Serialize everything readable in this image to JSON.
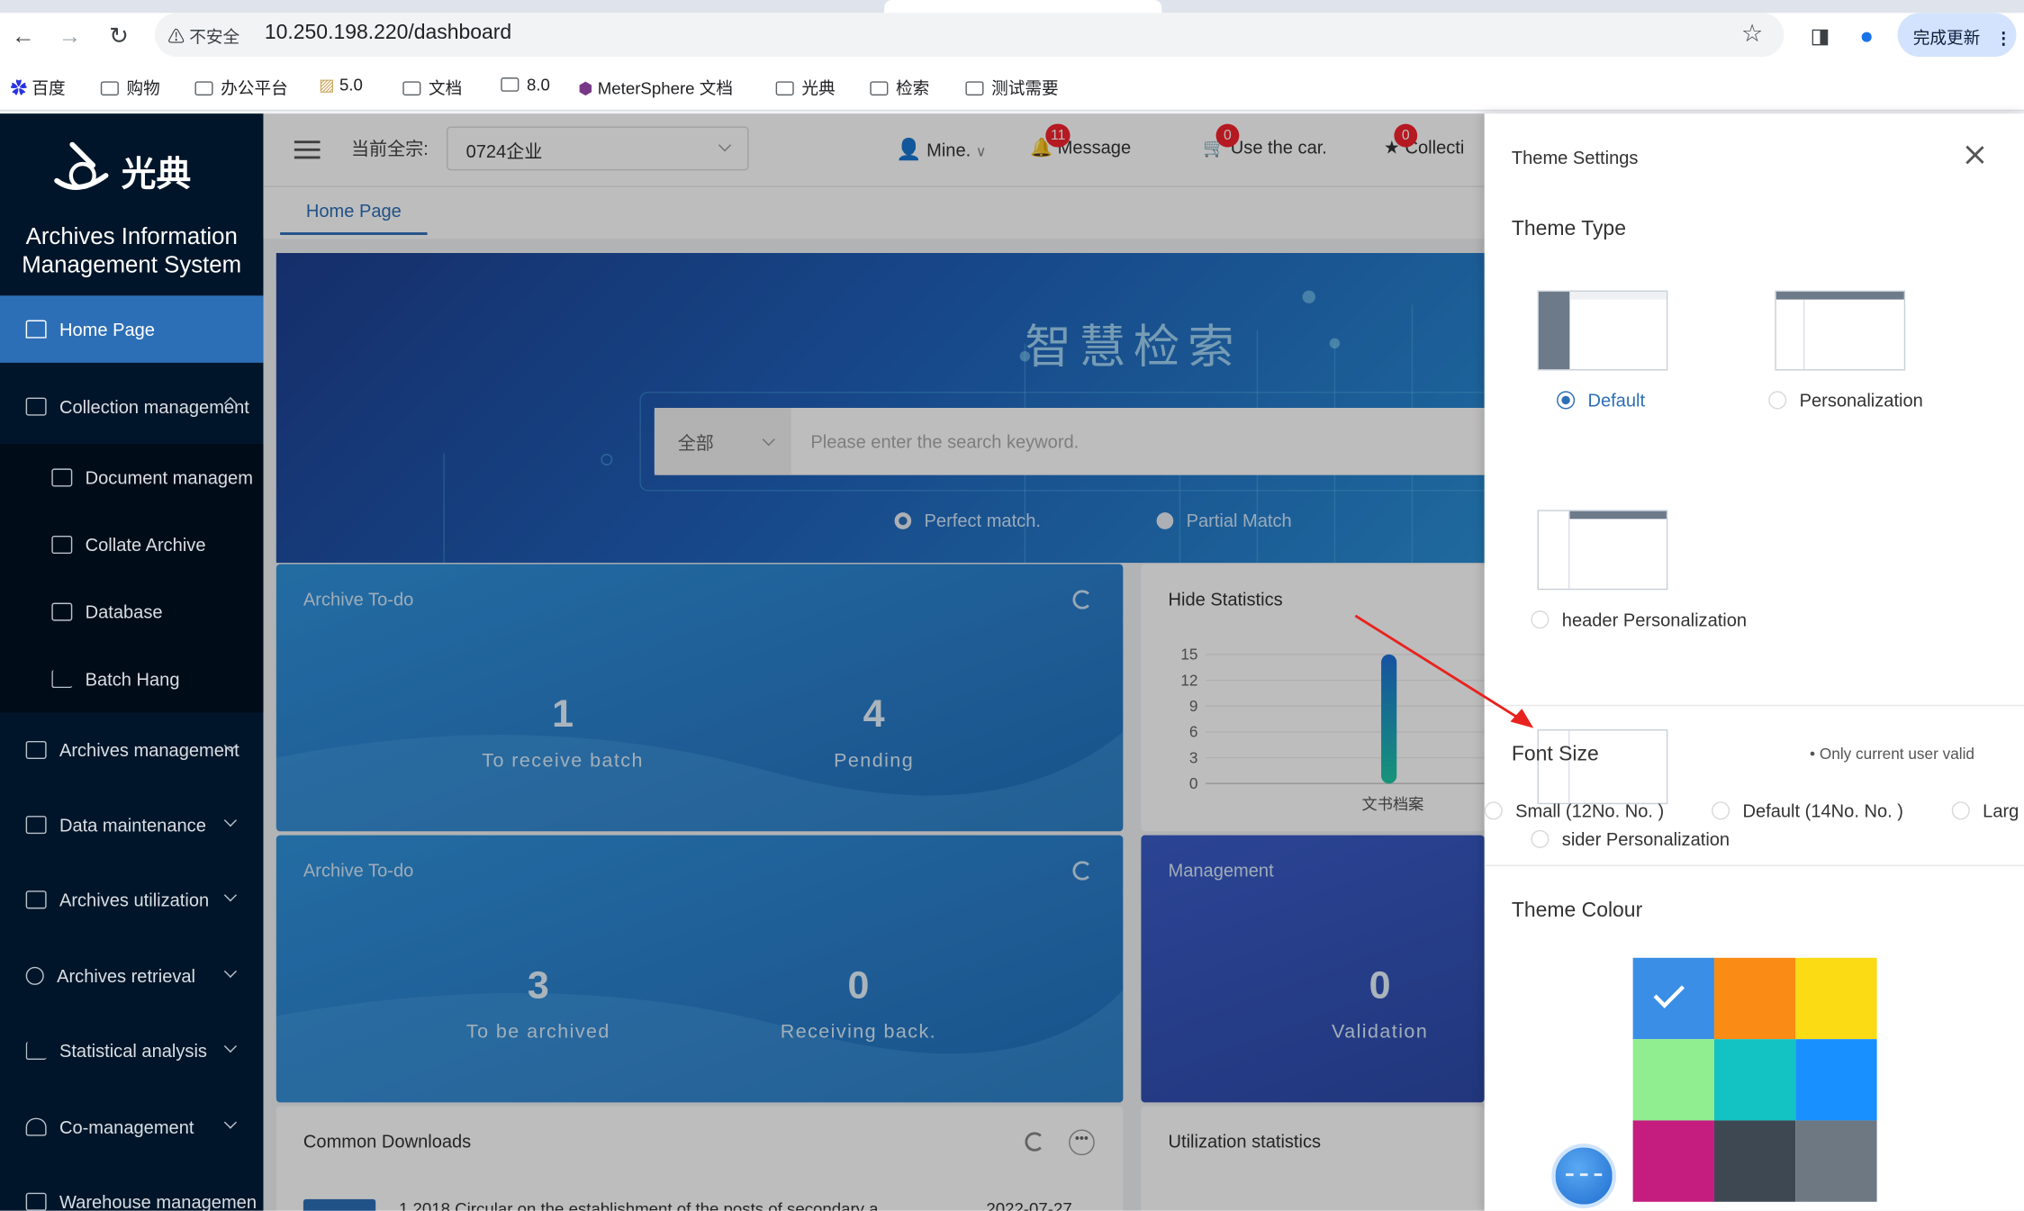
{
  "browser": {
    "insecure_label": "不安全",
    "url": "10.250.198.220/dashboard",
    "update_label": "完成更新",
    "bookmarks": [
      "百度",
      "购物",
      "办公平台",
      "5.0",
      "文档",
      "8.0",
      "MeterSphere 文档",
      "光典",
      "检索",
      "测试需要"
    ]
  },
  "app": {
    "logo_text": "光典",
    "system_title_line1": "Archives Information",
    "system_title_line2": "Management System"
  },
  "sidebar": {
    "items": [
      {
        "label": "Home Page",
        "icon": "home-icon"
      },
      {
        "label": "Collection management",
        "icon": "collection-icon"
      },
      {
        "label": "Document managem",
        "icon": "document-icon"
      },
      {
        "label": "Collate Archive",
        "icon": "file-icon"
      },
      {
        "label": "Database",
        "icon": "calendar-icon"
      },
      {
        "label": "Batch Hang",
        "icon": "bar-chart-icon"
      },
      {
        "label": "Archives management",
        "icon": "bank-icon"
      },
      {
        "label": "Data maintenance",
        "icon": "building-icon"
      },
      {
        "label": "Archives utilization",
        "icon": "clipboard-icon"
      },
      {
        "label": "Archives retrieval",
        "icon": "search-icon"
      },
      {
        "label": "Statistical analysis",
        "icon": "line-chart-icon"
      },
      {
        "label": "Co-management",
        "icon": "team-icon"
      },
      {
        "label": "Warehouse managemen",
        "icon": "warehouse-icon"
      }
    ]
  },
  "header": {
    "current_label": "当前全宗:",
    "current_value": "0724企业",
    "user": "Mine.",
    "message_label": "Message",
    "message_count": "11",
    "car_label": "Use the car.",
    "car_count": "0",
    "collect_label": "Collecti",
    "collect_count": "0"
  },
  "tabs": {
    "home": "Home Page"
  },
  "banner": {
    "title": "智慧检索",
    "scope": "全部",
    "placeholder": "Please enter the search keyword.",
    "match_exact": "Perfect match.",
    "match_partial": "Partial Match"
  },
  "cards": {
    "todo1": {
      "title": "Archive To-do",
      "a_value": "1",
      "a_label": "To receive batch",
      "b_value": "4",
      "b_label": "Pending"
    },
    "todo2": {
      "title": "Archive To-do",
      "a_value": "3",
      "a_label": "To be archived",
      "b_value": "0",
      "b_label": "Receiving back."
    },
    "hide_stats": {
      "title": "Hide Statistics",
      "ticks": [
        "15",
        "12",
        "9",
        "6",
        "3",
        "0"
      ],
      "bar_label": "文书档案"
    },
    "management": {
      "title": "Management",
      "value": "0",
      "label": "Validation"
    },
    "downloads": {
      "title": "Common Downloads",
      "row_text": "1.2018 Circular on the establishment of the posts of secondary a",
      "row_date": "2022-07-27"
    },
    "utilization": {
      "title": "Utilization statistics"
    }
  },
  "chart_data": {
    "type": "bar",
    "categories": [
      "文书档案"
    ],
    "values": [
      15
    ],
    "title": "Hide Statistics",
    "ylim": [
      0,
      15
    ]
  },
  "drawer": {
    "title": "Theme Settings",
    "theme_type_title": "Theme Type",
    "theme_options": [
      "Default",
      "Personalization",
      "header Personalization",
      "sider Personalization"
    ],
    "font_size_title": "Font Size",
    "font_note": "Only current user valid",
    "font_options": [
      "Small (12No. No. )",
      "Default (14No. No. )",
      "Larg"
    ],
    "theme_colour_title": "Theme Colour",
    "colours": [
      "#3a8ee6",
      "#fa8c16",
      "#fadb14",
      "#90ee90",
      "#13c2c2",
      "#1890ff",
      "#c41d7f",
      "#3d4853",
      "#6e7882"
    ]
  }
}
